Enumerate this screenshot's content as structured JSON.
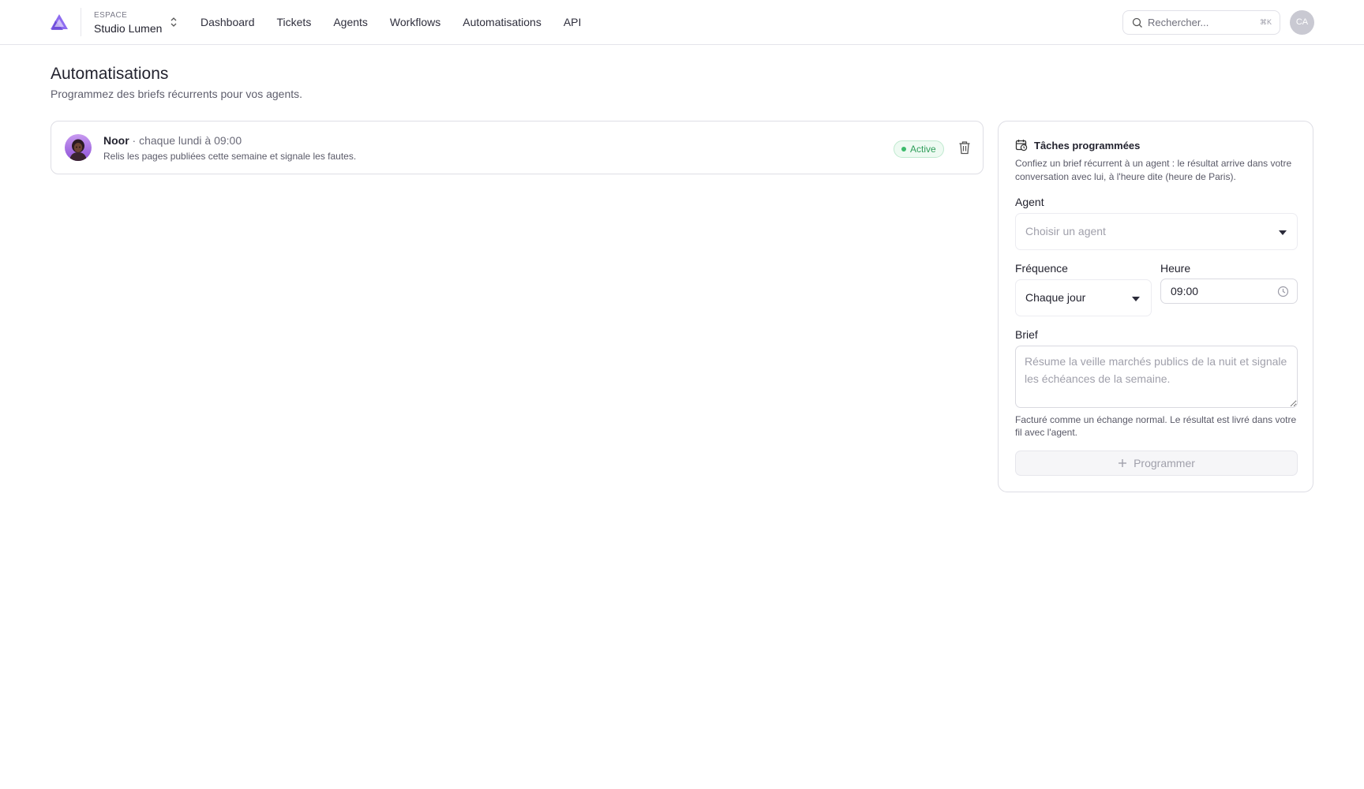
{
  "header": {
    "workspace_label": "ESPACE",
    "workspace_name": "Studio Lumen",
    "nav": [
      "Dashboard",
      "Tickets",
      "Agents",
      "Workflows",
      "Automatisations",
      "API"
    ],
    "search_placeholder": "Rechercher...",
    "search_shortcut": "⌘K",
    "avatar_initials": "CA"
  },
  "page": {
    "title": "Automatisations",
    "subtitle": "Programmez des briefs récurrents pour vos agents."
  },
  "schedules": [
    {
      "agent": "Noor",
      "schedule": " · chaque lundi à 09:00",
      "brief": "Relis les pages publiées cette semaine et signale les fautes.",
      "status": "Active"
    }
  ],
  "panel": {
    "title": "Tâches programmées",
    "description": "Confiez un brief récurrent à un agent : le résultat arrive dans votre conversation avec lui, à l'heure dite (heure de Paris).",
    "agent_label": "Agent",
    "agent_placeholder": "Choisir un agent",
    "frequency_label": "Fréquence",
    "frequency_value": "Chaque jour",
    "time_label": "Heure",
    "time_value": "09:00",
    "brief_label": "Brief",
    "brief_placeholder": "Résume la veille marchés publics de la nuit et signale les échéances de la semaine.",
    "hint": "Facturé comme un échange normal. Le résultat est livré dans votre fil avec l'agent.",
    "submit_label": "Programmer"
  },
  "colors": {
    "brand": "#7b5ce0",
    "active_green": "#2f9e5a",
    "text_dark": "#23232f",
    "muted": "#5a5a68"
  }
}
